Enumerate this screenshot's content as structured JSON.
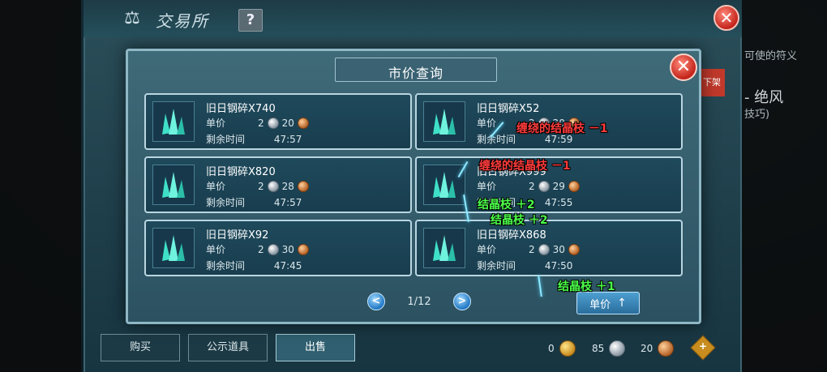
{
  "exchange": {
    "title": "交易所",
    "help_label": "?",
    "close_label": "✕",
    "side_button": "下架",
    "bg_text_1": "可使的符义",
    "bg_text_2": "- 绝风",
    "bg_text_3": "技巧)",
    "tabs": [
      {
        "label": "购买"
      },
      {
        "label": "公示道具"
      },
      {
        "label": "出售"
      }
    ],
    "currency": {
      "gold": "0",
      "silver": "85",
      "bronze": "20",
      "add_label": "+"
    }
  },
  "modal": {
    "title": "市价查询",
    "close_label": "✕",
    "price_label": "单价",
    "time_label": "剩余时间",
    "listings": [
      {
        "name": "旧日钢碎X740",
        "silver": "2",
        "bronze": "20",
        "time": "47:57"
      },
      {
        "name": "旧日钢碎X52",
        "silver": "2",
        "bronze": "20",
        "time": "47:59"
      },
      {
        "name": "旧日钢碎X820",
        "silver": "2",
        "bronze": "28",
        "time": "47:57"
      },
      {
        "name": "旧日钢碎X999",
        "silver": "2",
        "bronze": "29",
        "time": "47:55"
      },
      {
        "name": "旧日钢碎X92",
        "silver": "2",
        "bronze": "30",
        "time": "47:45"
      },
      {
        "name": "旧日钢碎X868",
        "silver": "2",
        "bronze": "30",
        "time": "47:50"
      }
    ],
    "pager": {
      "prev": "<",
      "page": "1/12",
      "next": ">"
    },
    "sort_label": "单价",
    "sort_arrow": "↑"
  },
  "floats": {
    "red1": "缠绕的结晶枝 －1",
    "red2": "缠绕的结晶枝 －1",
    "green1": "结晶枝 ＋2",
    "green2": "结晶枝 ＋2",
    "green3": "结晶枝 ＋1"
  },
  "colors": {
    "accent": "#8fb7c6",
    "loss": "#ff3b3b",
    "gain": "#4cff4a",
    "close": "#c4231a"
  }
}
